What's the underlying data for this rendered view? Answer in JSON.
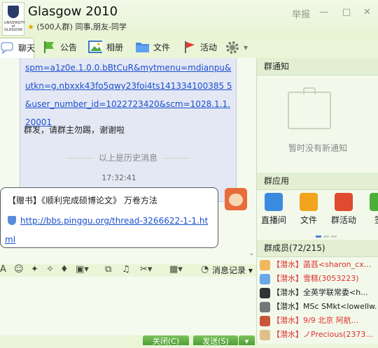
{
  "header": {
    "title": "Glasgow 2010",
    "subtitle": "(500人群) 同事,朋友-同学",
    "logo_text": "UNIVERSITY of GLASGOW",
    "report_label": "举报"
  },
  "tabs": [
    {
      "label": "聊天",
      "icon": "chat-icon"
    },
    {
      "label": "公告",
      "icon": "flag-icon"
    },
    {
      "label": "相册",
      "icon": "photo-icon"
    },
    {
      "label": "文件",
      "icon": "folder-icon"
    },
    {
      "label": "活动",
      "icon": "pennant-icon"
    },
    {
      "label": "",
      "icon": "gear-icon"
    }
  ],
  "chat": {
    "msg1_link": "spm=a1z0e.1.0.0.bBtCuR&mytmenu=mdianpu&utkn=g.nbxxk43fo5qwy23foi4ts141334100385 5&user_number_id=1022723420&scm=1028.1.1.20001",
    "msg1_text": "群发，请群主勿踢，谢谢啦",
    "history_sep": "以上是历史消息",
    "time": "17:32:41",
    "msg2_title": "【赠书】《顺利完成硕博论文》 万卷方法",
    "msg2_link": "http://bbs.pinggu.org/thread-3266622-1-1.html"
  },
  "toolbar": {
    "history_label": "消息记录"
  },
  "buttons": {
    "close": "关闭(C)",
    "send": "发送(S)"
  },
  "right_panel": {
    "notice_title": "群通知",
    "notice_empty": "暂时没有新通知",
    "apps_title": "群应用",
    "apps": [
      {
        "label": "直播间",
        "color": "#3a8be0"
      },
      {
        "label": "文件",
        "color": "#f2a41f"
      },
      {
        "label": "群活动",
        "color": "#e04a2f"
      },
      {
        "label": "签",
        "color": "#4fae3a"
      }
    ],
    "members_title": "群成员(72/215)",
    "members": [
      {
        "badge": "【潜水】",
        "name": "菡萏<sharon_cx...",
        "red": true
      },
      {
        "badge": "【潜水】",
        "name": "雪糕(3053223)",
        "red": true
      },
      {
        "badge": "【潜水】",
        "name": "全英学联常委<h...",
        "red": false
      },
      {
        "badge": "【潜水】",
        "name": "MSc SMkt<lowellw...",
        "red": false
      },
      {
        "badge": "【潜水】",
        "name": "9/9 北京 阿航...",
        "red": true
      },
      {
        "badge": "【潜水】",
        "name": "ノPrecious(2373...",
        "red": true
      }
    ]
  },
  "colors": {
    "accent_green": "#4e9e35",
    "link_blue": "#1a4fd0",
    "member_red": "#e03030"
  }
}
